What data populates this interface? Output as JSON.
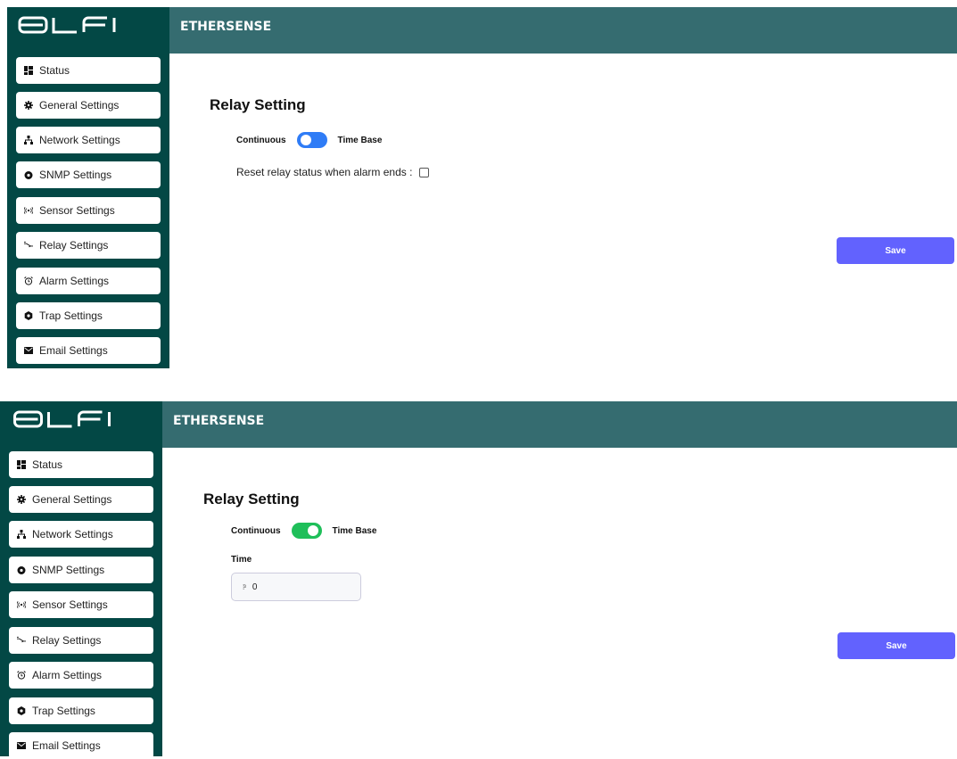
{
  "header": {
    "title": "ETHERSENSE"
  },
  "nav": [
    {
      "label": "Status",
      "icon": "dashboard-icon"
    },
    {
      "label": "General Settings",
      "icon": "gear-icon"
    },
    {
      "label": "Network Settings",
      "icon": "network-icon"
    },
    {
      "label": "SNMP Settings",
      "icon": "snmp-gear-icon"
    },
    {
      "label": "Sensor Settings",
      "icon": "broadcast-icon"
    },
    {
      "label": "Relay Settings",
      "icon": "relay-icon"
    },
    {
      "label": "Alarm Settings",
      "icon": "alarm-clock-icon"
    },
    {
      "label": "Trap Settings",
      "icon": "hexagon-icon"
    },
    {
      "label": "Email Settings",
      "icon": "envelope-icon"
    }
  ],
  "main": {
    "title": "Relay Setting",
    "toggle_left": "Continuous",
    "toggle_right": "Time Base",
    "reset_label": "Reset relay status when alarm ends :",
    "save_label": "Save",
    "time_label": "Time",
    "time_value": "0"
  },
  "colors": {
    "sidebar": "#034845",
    "header": "#356c70",
    "toggle_off": "#2f7cf6",
    "toggle_on": "#1fbf5a",
    "save": "#6262fe"
  }
}
